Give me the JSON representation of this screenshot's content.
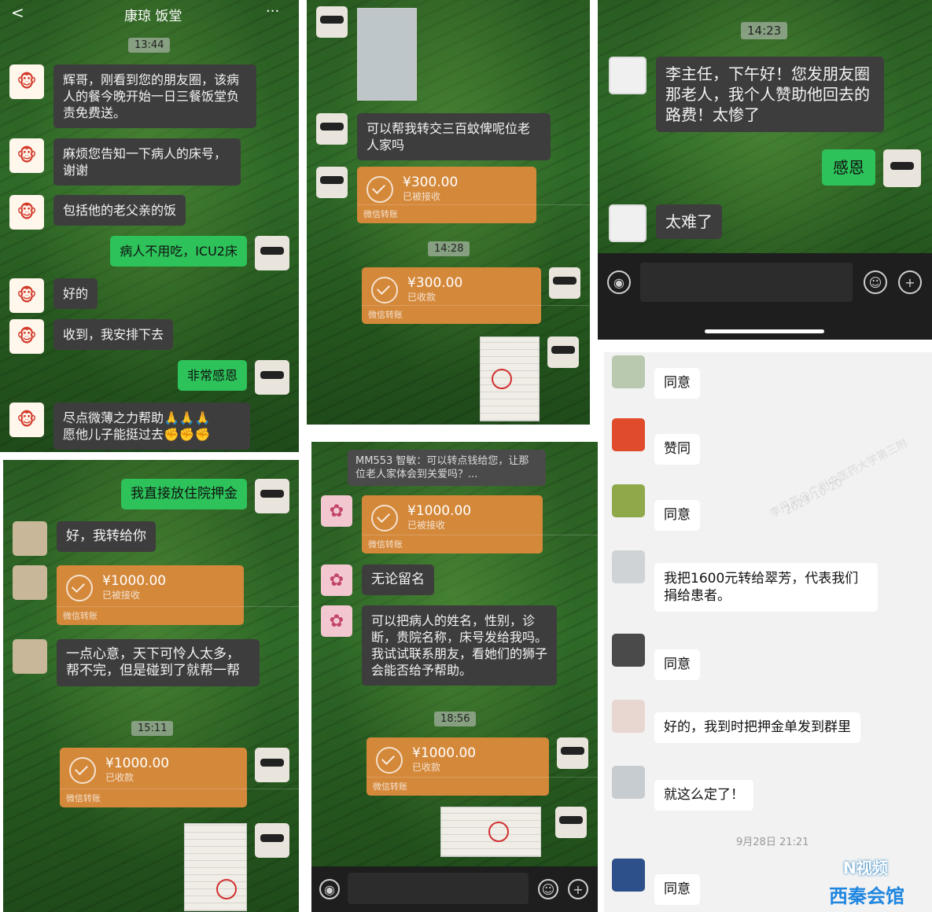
{
  "panel1": {
    "header": {
      "back": "<",
      "title": "康琼 饭堂",
      "more": "···"
    },
    "time": "13:44",
    "messages": [
      "辉哥，刚看到您的朋友圈，该病人的餐今晚开始一日三餐饭堂负责免费送。",
      "麻烦您告知一下病人的床号，谢谢",
      "包括他的老父亲的饭",
      "病人不用吃，ICU2床",
      "好的",
      "收到，我安排下去",
      "非常感恩",
      "尽点微薄之力帮助🙏🙏🙏\n愿他儿子能挺过去✊✊✊"
    ]
  },
  "panel2": {
    "message1": "可以帮我转交三百蚊俾呢位老人家吗",
    "transfer1": {
      "amount": "¥300.00",
      "status": "已被接收",
      "footer": "微信转账"
    },
    "time": "14:28",
    "transfer2": {
      "amount": "¥300.00",
      "status": "已收款",
      "footer": "微信转账"
    }
  },
  "panel3": {
    "time": "14:23",
    "message1": "李主任，下午好！您发朋友圈那老人，我个人赞助他回去的路费！太惨了",
    "message2": "感恩",
    "message3": "太难了"
  },
  "panel4": {
    "message1": "我直接放住院押金",
    "message2": "好，我转给你",
    "transfer1": {
      "amount": "¥1000.00",
      "status": "已被接收",
      "footer": "微信转账"
    },
    "message3": "一点心意，天下可怜人太多，帮不完，但是碰到了就帮一帮",
    "time": "15:11",
    "transfer2": {
      "amount": "¥1000.00",
      "status": "已收款",
      "footer": "微信转账"
    }
  },
  "panel5": {
    "quote": "MM553 智敏：可以转点钱给您，让那位老人家体会到关爱吗？...",
    "transfer1": {
      "amount": "¥1000.00",
      "status": "已被接收",
      "footer": "微信转账"
    },
    "message1": "无论留名",
    "message2": "可以把病人的姓名，性别，诊断，贵院名称，床号发给我吗。我试试联系朋友，看她们的狮子会能否给予帮助。",
    "time": "18:56",
    "transfer2": {
      "amount": "¥1000.00",
      "status": "已收款",
      "footer": "微信转账"
    }
  },
  "panel6": {
    "messages": [
      "同意",
      "赞同",
      "同意",
      "我把1600元转给翠芳，代表我们捐给患者。",
      "同意",
      "好的，我到时把押金单发到群里",
      "就这么定了！"
    ],
    "time": "9月28日 21:21",
    "last_message": "同意",
    "watermark1": "李丹芳@广州中医药大学第三附",
    "watermark2": "2023-10-20",
    "logo1": "N视频",
    "logo2": "西秦会馆"
  }
}
